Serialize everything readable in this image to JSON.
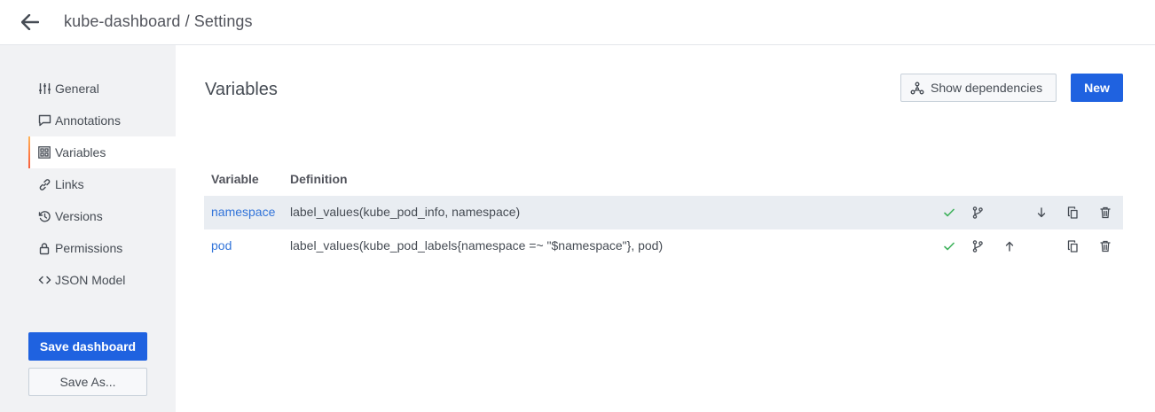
{
  "header": {
    "title": "kube-dashboard / Settings",
    "back_icon": "arrow-left-icon"
  },
  "sidebar": {
    "items": [
      {
        "label": "General",
        "icon": "sliders-icon",
        "active": false
      },
      {
        "label": "Annotations",
        "icon": "comment-icon",
        "active": false
      },
      {
        "label": "Variables",
        "icon": "calculator-icon",
        "active": true
      },
      {
        "label": "Links",
        "icon": "link-icon",
        "active": false
      },
      {
        "label": "Versions",
        "icon": "history-icon",
        "active": false
      },
      {
        "label": "Permissions",
        "icon": "lock-icon",
        "active": false
      },
      {
        "label": "JSON Model",
        "icon": "code-icon",
        "active": false
      }
    ],
    "save_label": "Save dashboard",
    "save_as_label": "Save As..."
  },
  "main": {
    "title": "Variables",
    "show_deps_label": "Show dependencies",
    "new_label": "New",
    "table": {
      "columns": [
        "Variable",
        "Definition"
      ],
      "rows": [
        {
          "name": "namespace",
          "definition": "label_values(kube_pod_info, namespace)",
          "can_move_up": false,
          "can_move_down": true
        },
        {
          "name": "pod",
          "definition": "label_values(kube_pod_labels{namespace =~ \"$namespace\"}, pod)",
          "can_move_up": true,
          "can_move_down": false
        }
      ]
    }
  },
  "colors": {
    "accent": "#1f62e0",
    "link": "#3274d9",
    "check": "#3eb15b",
    "active_border": "#ff7941"
  }
}
